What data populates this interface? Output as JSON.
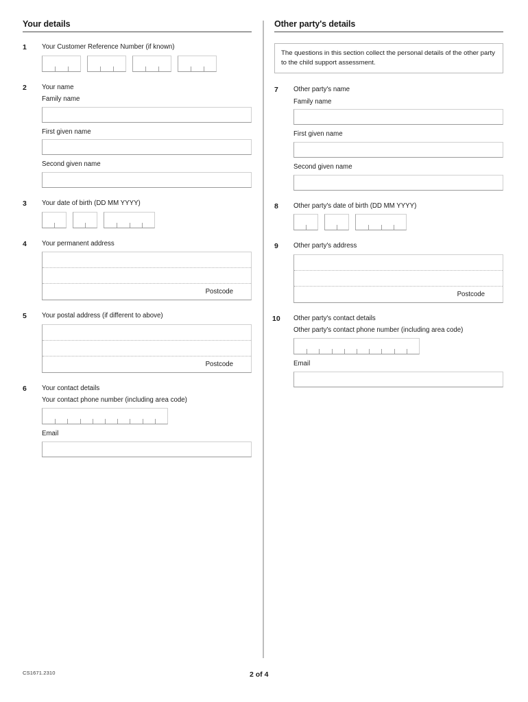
{
  "footer": {
    "form_code": "CS1671.2310",
    "page_label": "2 of 4"
  },
  "left_column": {
    "section_title": "Your details",
    "questions": [
      {
        "number": "1",
        "title": "Your Customer Reference Number (if known)",
        "type": "celled-groups",
        "groups": [
          3,
          3,
          3,
          3
        ]
      },
      {
        "number": "2",
        "title": "Your name",
        "type": "text-fields",
        "fields": [
          {
            "label": "Family name",
            "value": ""
          },
          {
            "label": "First given name",
            "value": ""
          },
          {
            "label": "Second given name",
            "value": ""
          }
        ]
      },
      {
        "number": "3",
        "title": "Your date of birth (DD MM YYYY)",
        "type": "date",
        "day_cells": 2,
        "month_cells": 2,
        "year_cells": 4
      },
      {
        "number": "4",
        "title": "Your permanent address",
        "type": "address",
        "lines": 2,
        "postcode_label": "Postcode"
      },
      {
        "number": "5",
        "title": "Your postal address (if different to above)",
        "type": "address",
        "lines": 2,
        "postcode_label": "Postcode"
      },
      {
        "number": "6",
        "title": "Your contact details",
        "type": "contact",
        "phone_label": "Your contact phone number (including area code)",
        "phone_cells": 10,
        "email_label": "Email",
        "email_value": ""
      }
    ]
  },
  "right_column": {
    "section_title": "Other party's details",
    "note": "The questions in this section collect the personal details of the other party to the child support assessment.",
    "questions": [
      {
        "number": "7",
        "title": "Other party's name",
        "type": "text-fields",
        "fields": [
          {
            "label": "Family name",
            "value": ""
          },
          {
            "label": "First given name",
            "value": ""
          },
          {
            "label": "Second given name",
            "value": ""
          }
        ]
      },
      {
        "number": "8",
        "title": "Other party's date of birth (DD MM YYYY)",
        "type": "date",
        "day_cells": 2,
        "month_cells": 2,
        "year_cells": 4
      },
      {
        "number": "9",
        "title": "Other party's address",
        "type": "address",
        "lines": 2,
        "postcode_label": "Postcode"
      },
      {
        "number": "10",
        "title": "Other party's contact details",
        "type": "contact",
        "phone_label": "Other party's contact phone number (including area code)",
        "phone_cells": 10,
        "email_label": "Email",
        "email_value": ""
      }
    ]
  }
}
